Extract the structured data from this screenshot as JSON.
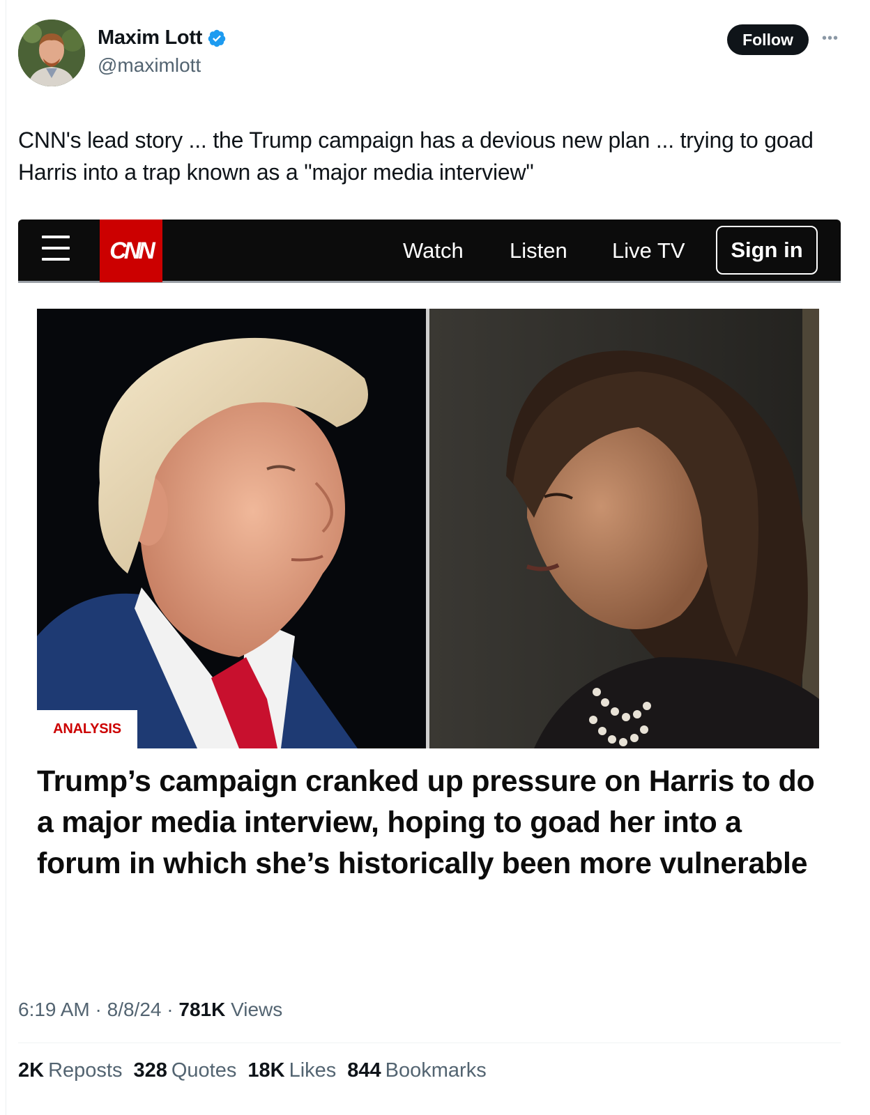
{
  "author": {
    "display_name": "Maxim Lott",
    "handle": "@maximlott",
    "verified_icon": "verified-badge-icon",
    "follow_label": "Follow",
    "more_icon": "more-icon"
  },
  "tweet": {
    "text": "CNN's lead story ... the Trump campaign has a devious new plan ... trying to goad Harris into a trap known as a \"major media interview\""
  },
  "cnn": {
    "logo_text": "CNN",
    "nav": [
      "Watch",
      "Listen",
      "Live TV"
    ],
    "signin_label": "Sign in",
    "badge": "ANALYSIS",
    "headline": "Trump’s campaign cranked up pressure on Harris to do a major media interview, hoping to goad her into a forum in which she’s historically been more vulnerable",
    "colors": {
      "brand_red": "#cc0000",
      "nav_bg": "#0c0c0c"
    }
  },
  "meta": {
    "time": "6:19 AM",
    "date": "8/8/24",
    "views_count": "781K",
    "views_label": "Views"
  },
  "stats": [
    {
      "count": "2K",
      "label": "Reposts"
    },
    {
      "count": "328",
      "label": "Quotes"
    },
    {
      "count": "18K",
      "label": "Likes"
    },
    {
      "count": "844",
      "label": "Bookmarks"
    }
  ],
  "colors": {
    "text": "#0f1419",
    "secondary": "#536471",
    "verified": "#1d9bf0"
  }
}
